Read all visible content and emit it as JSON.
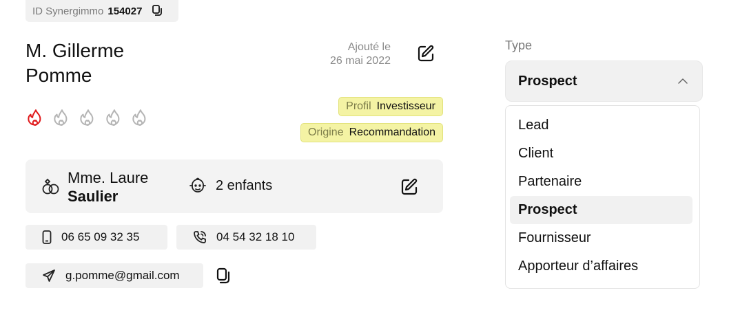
{
  "id_chip": {
    "label": "ID Synergimmo",
    "number": "154027"
  },
  "contact": {
    "name_line1": "M. Gillerme",
    "name_line2": "Pomme",
    "added_label": "Ajouté le",
    "added_date": "26 mai 2022",
    "rating": {
      "value": 1,
      "max": 5,
      "active_color": "#e0191b",
      "inactive_color": "#b5b5b5"
    }
  },
  "tags": {
    "profil": {
      "key": "Profil",
      "value": "Investisseur"
    },
    "origine": {
      "key": "Origine",
      "value": "Recommandation"
    }
  },
  "family": {
    "spouse_first": "Mme. Laure",
    "spouse_last": "Saulier",
    "children": "2 enfants"
  },
  "phones": {
    "mobile": "06 65 09 32 35",
    "landline": "04 54 32 18 10"
  },
  "email": "g.pomme@gmail.com",
  "type_select": {
    "label": "Type",
    "selected": "Prospect",
    "options": [
      "Lead",
      "Client",
      "Partenaire",
      "Prospect",
      "Fournisseur",
      "Apporteur d’affaires"
    ]
  },
  "colors": {
    "tag_bg": "#f4f3a4",
    "panel_bg": "#f1f1f1",
    "text": "#111111"
  }
}
